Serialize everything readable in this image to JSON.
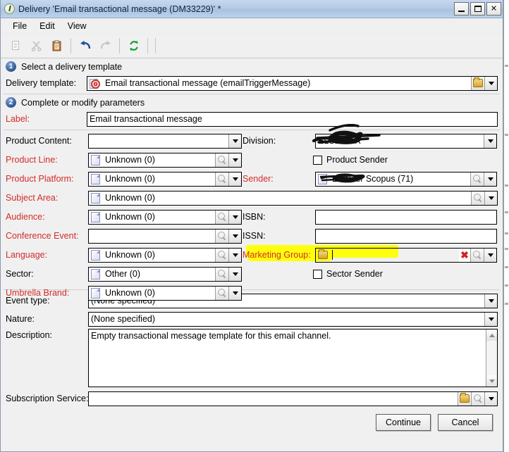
{
  "window": {
    "title": "Delivery 'Email transactional message (DM33229)' *",
    "title_icon": "delivery-icon",
    "buttons": {
      "minimize": "minimize-icon",
      "maximize": "maximize-icon",
      "close": "✕"
    }
  },
  "menu": {
    "items": [
      {
        "label": "File"
      },
      {
        "label": "Edit"
      },
      {
        "label": "View"
      }
    ]
  },
  "toolbar": {
    "items": [
      {
        "name": "copy-icon",
        "enabled": false
      },
      {
        "name": "cut-icon",
        "enabled": false
      },
      {
        "name": "paste-icon",
        "enabled": true
      },
      {
        "name": "undo-icon",
        "enabled": true
      },
      {
        "name": "redo-icon",
        "enabled": false
      },
      {
        "name": "refresh-icon",
        "enabled": true
      }
    ]
  },
  "steps": {
    "one": {
      "number": "1",
      "label": "Select a delivery template"
    },
    "two": {
      "number": "2",
      "label": "Complete or modify parameters"
    }
  },
  "fields": {
    "delivery_template": {
      "label": "Delivery template:",
      "value": "Email transactional message (emailTriggerMessage)",
      "icon": "template-icon"
    },
    "label": {
      "label": "Label:",
      "value": "Email transactional message",
      "required": true
    },
    "product_content": {
      "label": "Product Content:",
      "value": "",
      "required": false
    },
    "product_line": {
      "label": "Product Line:",
      "value": "Unknown (0)",
      "required": true
    },
    "product_platform": {
      "label": "Product Platform:",
      "value": "Unknown (0)",
      "required": true
    },
    "subject_area": {
      "label": "Subject Area:",
      "value": "Unknown (0)",
      "required": true
    },
    "audience": {
      "label": "Audience:",
      "value": "Unknown (0)",
      "required": true
    },
    "conference_event": {
      "label": "Conference Event:",
      "value": "",
      "required": true
    },
    "language": {
      "label": "Language:",
      "value": "Unknown (0)",
      "required": true
    },
    "sector": {
      "label": "Sector:",
      "value": "Other (0)",
      "required": false
    },
    "umbrella_brand": {
      "label": "Umbrella Brand:",
      "value": "Unknown (0)",
      "required": true
    },
    "division": {
      "label": "Division:",
      "value": "ELSEVIER",
      "required": false,
      "redacted": true
    },
    "product_sender": {
      "label": "Product Sender",
      "checked": false
    },
    "sender": {
      "label": "Sender:",
      "value": "Elsevier Scopus (71)",
      "required": true,
      "redacted": true
    },
    "sender_extra": {
      "label": "",
      "value": ""
    },
    "isbn": {
      "label": "ISBN:",
      "value": ""
    },
    "issn": {
      "label": "ISSN:",
      "value": ""
    },
    "marketing_group": {
      "label": "Marketing Group:",
      "value": "",
      "required": true,
      "highlighted": true
    },
    "sector_sender": {
      "label": "Sector Sender",
      "checked": false
    },
    "event_type": {
      "label": "Event type:",
      "value": "(None specified)"
    },
    "nature": {
      "label": "Nature:",
      "value": "(None specified)"
    },
    "description": {
      "label": "Description:",
      "value": "Empty transactional message template for this email channel."
    },
    "subscription_service": {
      "label": "Subscription Service:",
      "value": ""
    }
  },
  "actions": {
    "continue": "Continue",
    "cancel": "Cancel"
  },
  "colors": {
    "required_label": "#d32b2b",
    "highlight": "#ffff00",
    "titlebar": "#b4cbe6",
    "window_bg": "#f0f0f0"
  }
}
